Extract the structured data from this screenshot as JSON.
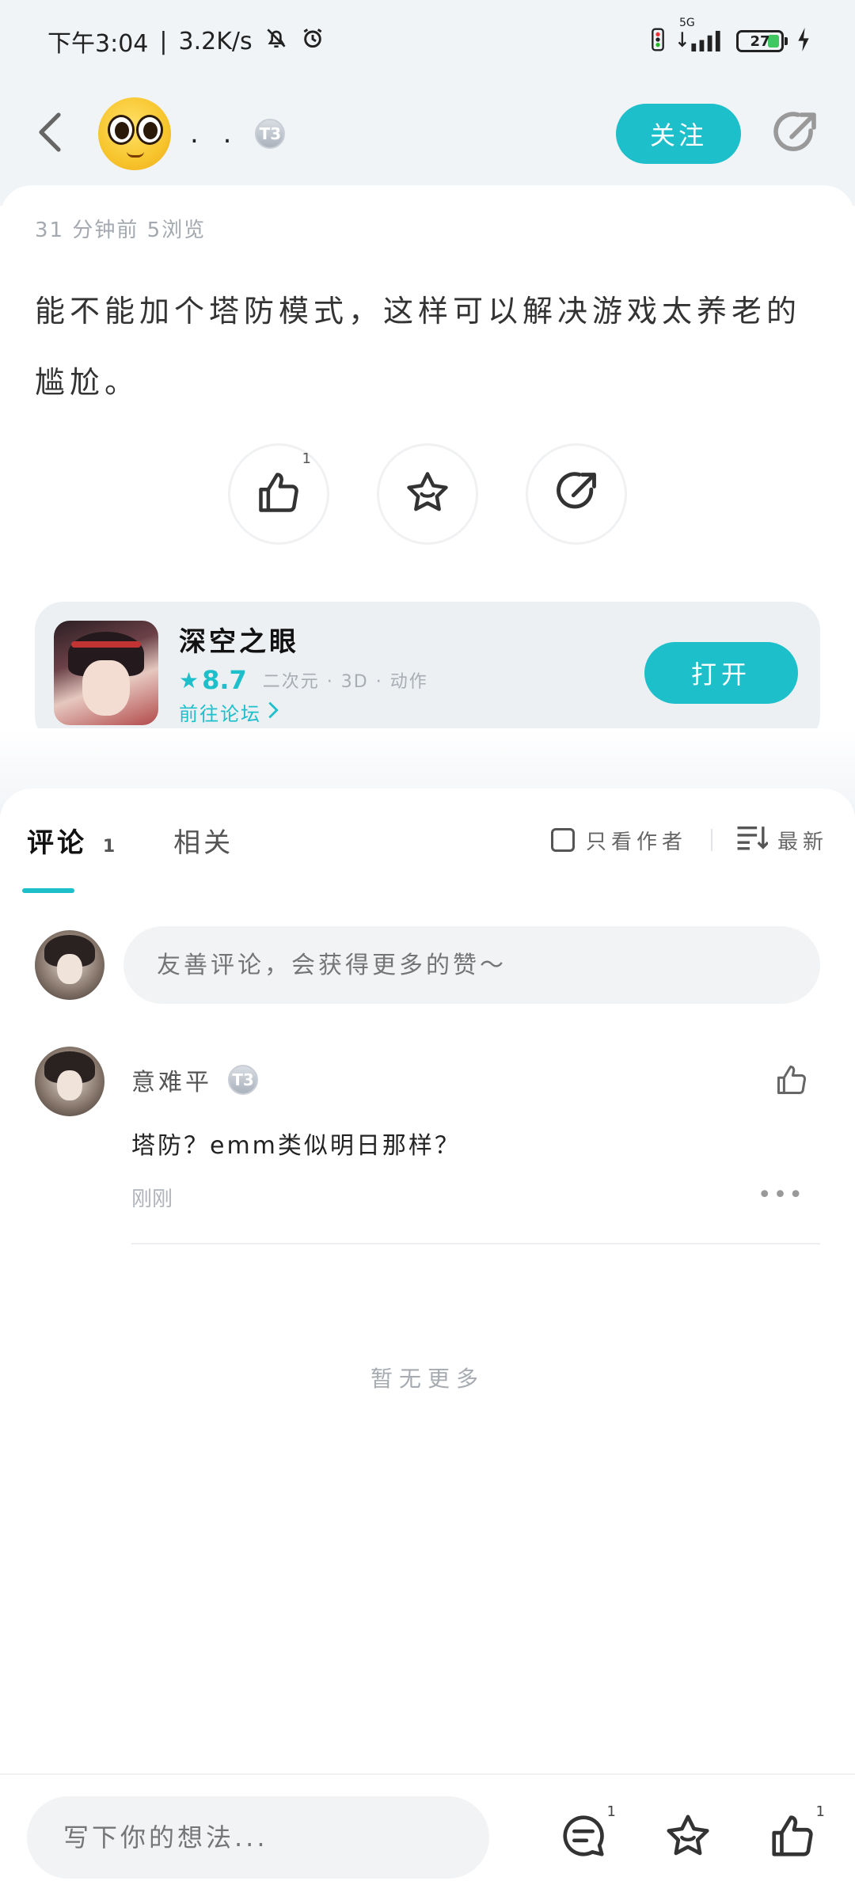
{
  "status_bar": {
    "time": "下午3:04",
    "speed": "3.2K/s",
    "network": "5G",
    "battery": "27"
  },
  "header": {
    "author_name": ". .",
    "level": "T3",
    "follow_label": "关注"
  },
  "post": {
    "meta": "31 分钟前  5浏览",
    "text": "能不能加个塔防模式，这样可以解决游戏太养老的尴尬。",
    "like_count": "1"
  },
  "game": {
    "name": "深空之眼",
    "score": "8.7",
    "tags": "二次元 · 3D · 动作",
    "forum_link": "前往论坛",
    "open_label": "打开"
  },
  "comments_section": {
    "tabs": [
      {
        "label": "评论",
        "count": "1"
      },
      {
        "label": "相关"
      }
    ],
    "filter_author_only": "只看作者",
    "sort_label": "最新",
    "input_placeholder": "友善评论，会获得更多的赞～",
    "items": [
      {
        "author": "意难平",
        "level": "T3",
        "text": "塔防？emm类似明日那样？",
        "time": "刚刚"
      }
    ],
    "no_more": "暂无更多"
  },
  "bottom_bar": {
    "placeholder": "写下你的想法...",
    "comment_count": "1",
    "like_count": "1"
  },
  "colors": {
    "accent": "#1cbfca",
    "page_bg": "#f1f4f7"
  }
}
